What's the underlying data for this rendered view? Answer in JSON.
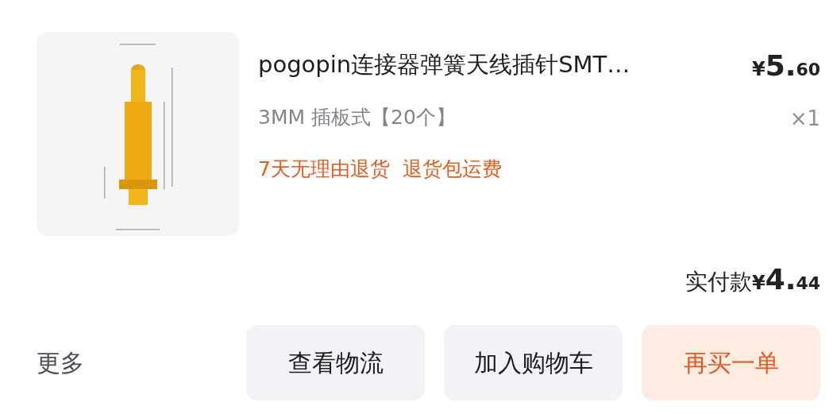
{
  "product": {
    "image": {
      "kind": "picture"
    },
    "title": "pogopin连接器弹簧天线插针SMT…",
    "spec": "3MM 插板式【20个】",
    "tags": [
      "7天无理由退货",
      "退货包运费"
    ],
    "price": {
      "currency": "¥",
      "integer": "5.",
      "decimal": "60"
    },
    "quantity": "×1"
  },
  "paid": {
    "label": "实付款",
    "currency": "¥",
    "integer": "4.",
    "decimal": "44"
  },
  "more": "更多",
  "buttons": [
    {
      "label": "查看物流",
      "kind": "plain"
    },
    {
      "label": "加入购物车",
      "kind": "plain"
    },
    {
      "label": "再买一单",
      "kind": "primary"
    }
  ]
}
